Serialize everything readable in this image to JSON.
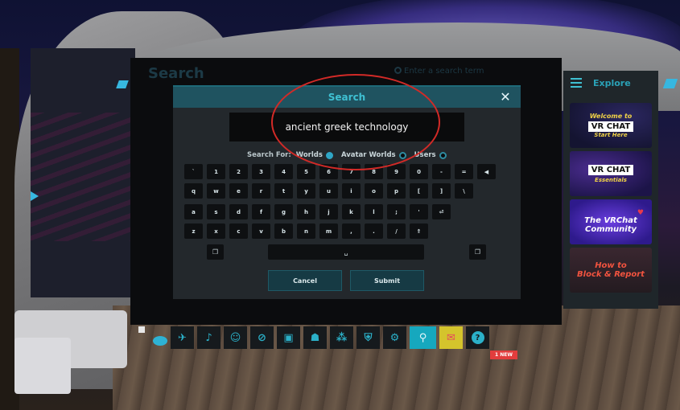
{
  "menu": {
    "title": "Search",
    "search_placeholder": "Enter a search term"
  },
  "dialog": {
    "title": "Search",
    "close_label": "✕",
    "query": "ancient greek technology",
    "search_for_label": "Search For:",
    "options": [
      {
        "label": "Worlds",
        "selected": true
      },
      {
        "label": "Avatar Worlds",
        "selected": false
      },
      {
        "label": "Users",
        "selected": false
      }
    ],
    "keyboard": {
      "row1": [
        "`",
        "1",
        "2",
        "3",
        "4",
        "5",
        "6",
        "7",
        "8",
        "9",
        "0",
        "-",
        "=",
        "◀"
      ],
      "row2": [
        "q",
        "w",
        "e",
        "r",
        "t",
        "y",
        "u",
        "i",
        "o",
        "p",
        "[",
        "]",
        "\\"
      ],
      "row3": [
        "a",
        "s",
        "d",
        "f",
        "g",
        "h",
        "j",
        "k",
        "l",
        ";",
        "'",
        "⏎"
      ],
      "row4": [
        "z",
        "x",
        "c",
        "v",
        "b",
        "n",
        "m",
        ",",
        ".",
        "/",
        "⇑"
      ],
      "copy_key": "❐",
      "space_key": "␣",
      "paste_key": "❐"
    },
    "cancel_label": "Cancel",
    "submit_label": "Submit"
  },
  "explore": {
    "title": "Explore",
    "cards": [
      {
        "line1": "Welcome to",
        "logo": "VR CHAT",
        "line3": "Start Here"
      },
      {
        "logo": "VR CHAT",
        "line3": "Essentials"
      },
      {
        "line1": "The VRChat",
        "line2": "Community"
      },
      {
        "line1": "How to",
        "line2": "Block & Report"
      }
    ]
  },
  "toolbar": {
    "icons": [
      "rocket-icon",
      "bell-icon",
      "person-icon",
      "slash-icon",
      "gallery-icon",
      "people-icon",
      "network-icon",
      "shield-icon",
      "gear-icon",
      "search-icon",
      "chat-icon",
      "help-icon"
    ],
    "new_badge": "1 NEW"
  },
  "colors": {
    "accent": "#2bb0c8",
    "annotation": "#d22a27",
    "badge": "#e23d3d"
  }
}
